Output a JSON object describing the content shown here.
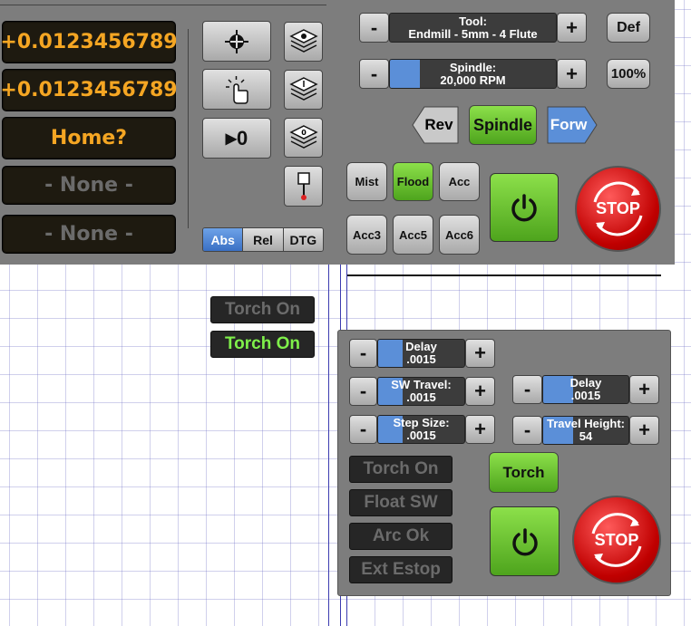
{
  "dro": {
    "x_value": "+0.0123456789",
    "y_value": "+0.0123456789",
    "z_value": "Home?",
    "a_value": "- None -",
    "b_value": "- None -"
  },
  "coord_mode": {
    "abs": "Abs",
    "rel": "Rel",
    "dtg": "DTG",
    "selected": "Abs"
  },
  "zero_label": "0",
  "tool": {
    "title": "Tool:",
    "value": "Endmill -  5mm - 4 Flute",
    "minus": "-",
    "plus": "+",
    "def": "Def"
  },
  "spindle": {
    "title": "Spindle:",
    "value": "20,000 RPM",
    "minus": "-",
    "plus": "+",
    "override": "100%",
    "level": 0.18
  },
  "spindle_controls": {
    "rev": "Rev",
    "spindle": "Spindle",
    "forw": "Forw"
  },
  "coolant": {
    "mist": "Mist",
    "flood": "Flood",
    "acc": "Acc",
    "acc3": "Acc3",
    "acc5": "Acc5",
    "acc6": "Acc6"
  },
  "estop_label": "STOP",
  "torch_samples": {
    "off": "Torch On",
    "on": "Torch On"
  },
  "thc": {
    "delay_left": {
      "title": "Delay",
      "value": ".0015",
      "level": 0.28
    },
    "sw_travel": {
      "title": "SW Travel:",
      "value": ".0015",
      "level": 0.28
    },
    "step_size": {
      "title": "Step Size:",
      "value": ".0015",
      "level": 0.28
    },
    "delay_right": {
      "title": "Delay",
      "value": ".0015",
      "level": 0.35
    },
    "travel_height": {
      "title": "Travel Height:",
      "value": "54",
      "level": 0.35
    },
    "minus": "-",
    "plus": "+",
    "torch_button": "Torch",
    "status": [
      "Torch On",
      "Float SW",
      "Arc Ok",
      "Ext Estop"
    ]
  },
  "colors": {
    "panel": "#7d7d7d",
    "dro_text": "#f5a623",
    "accent_blue": "#5b8fd8",
    "accent_green": "#6ec232",
    "estop_red": "#c00000"
  }
}
